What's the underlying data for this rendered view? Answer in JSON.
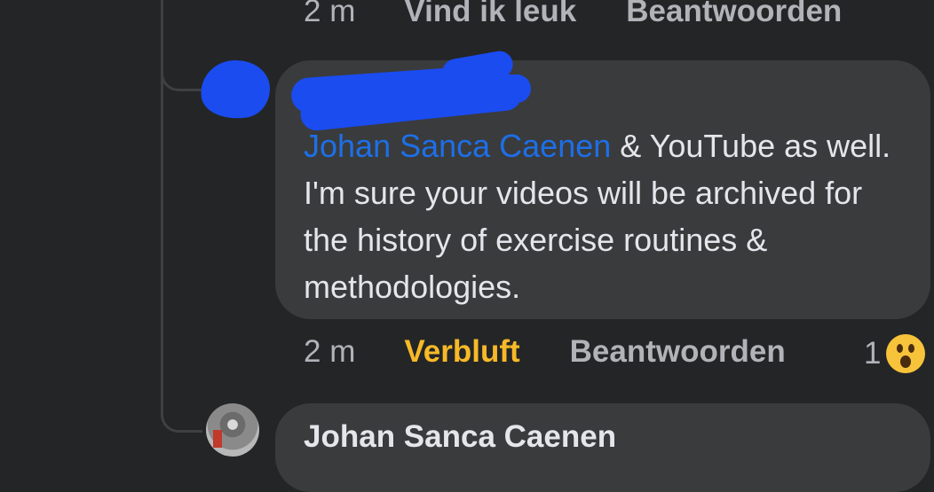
{
  "comment_top": {
    "time": "2 m",
    "like_label": "Vind ik leuk",
    "reply_label": "Beantwoorden"
  },
  "comment_main": {
    "mention": "Johan Sanca Caenen",
    "text": " & YouTube as well. I'm sure your videos will be archived for the history of exercise routines & methodologies.",
    "time": "2 m",
    "reaction_label": "Verbluft",
    "reply_label": "Beantwoorden",
    "reaction_count": "1",
    "reaction_icon": "wow-emoji-icon",
    "reaction_color": "#f7b928",
    "mention_color": "#1d6fe8"
  },
  "comment_next": {
    "author": "Johan Sanca Caenen"
  }
}
